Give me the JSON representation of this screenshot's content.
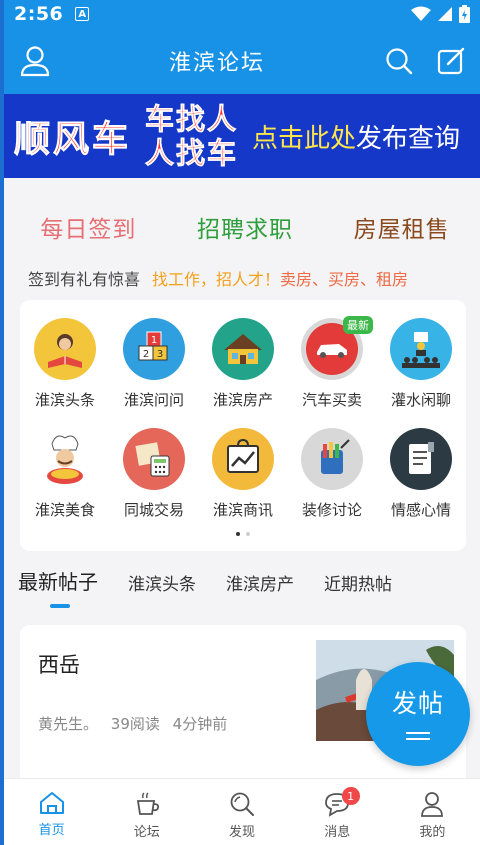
{
  "status_bar": {
    "time": "2:56",
    "notification_letter": "A"
  },
  "header": {
    "title": "淮滨论坛"
  },
  "banner": {
    "part1": "顺风车",
    "part2_line1": "车找人",
    "part2_line2": "人找车",
    "part3": "点击此处",
    "part4": "发布查询"
  },
  "quick_links": [
    {
      "label": "每日签到",
      "sub": "签到有礼有惊喜",
      "color": "#e66f74",
      "sub_color": "#444444"
    },
    {
      "label": "招聘求职",
      "sub": "找工作，招人才！",
      "color": "#2f9e3c",
      "sub_color": "#f3a01c"
    },
    {
      "label": "房屋租售",
      "sub": "卖房、买房、租房",
      "color": "#8a4a1e",
      "sub_color": "#ef6a45"
    }
  ],
  "categories": [
    {
      "label": "淮滨头条",
      "icon": "reading-person-icon"
    },
    {
      "label": "淮滨问问",
      "icon": "number-blocks-icon"
    },
    {
      "label": "淮滨房产",
      "icon": "house-icon"
    },
    {
      "label": "汽车买卖",
      "icon": "car-icon",
      "badge": "最新"
    },
    {
      "label": "灌水闲聊",
      "icon": "meeting-icon"
    },
    {
      "label": "淮滨美食",
      "icon": "chef-icon"
    },
    {
      "label": "同城交易",
      "icon": "calculator-icon"
    },
    {
      "label": "淮滨商讯",
      "icon": "chart-bag-icon"
    },
    {
      "label": "装修讨论",
      "icon": "paint-tools-icon"
    },
    {
      "label": "情感心情",
      "icon": "notebook-icon"
    }
  ],
  "pager": {
    "total": 2,
    "current": 1
  },
  "feed_tabs": [
    "最新帖子",
    "淮滨头条",
    "淮滨房产",
    "近期热帖"
  ],
  "posts": [
    {
      "title": "西岳",
      "author": "黄先生。",
      "reads": "39阅读",
      "time": "4分钟前"
    }
  ],
  "fab": {
    "label": "发帖"
  },
  "bottom_nav": [
    {
      "label": "首页",
      "icon": "home-icon",
      "active": true
    },
    {
      "label": "论坛",
      "icon": "coffee-cup-icon"
    },
    {
      "label": "发现",
      "icon": "search-icon"
    },
    {
      "label": "消息",
      "icon": "message-icon",
      "badge": "1"
    },
    {
      "label": "我的",
      "icon": "profile-icon"
    }
  ],
  "colors": {
    "primary": "#1792e6",
    "banner_bg": "#1638c8",
    "active_tab": "#1792e6",
    "badge": "#f04848"
  }
}
